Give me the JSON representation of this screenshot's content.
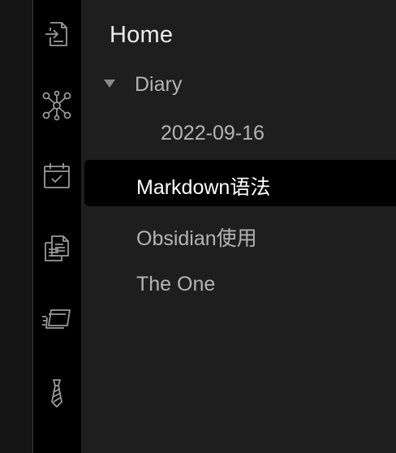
{
  "ribbon": {
    "icons": [
      {
        "name": "open-file-icon"
      },
      {
        "name": "graph-view-icon"
      },
      {
        "name": "daily-note-icon"
      },
      {
        "name": "copy-note-icon"
      },
      {
        "name": "slides-icon"
      },
      {
        "name": "plugin-icon"
      }
    ]
  },
  "sidebar": {
    "title": "Home",
    "folder": {
      "label": "Diary",
      "expanded": true
    },
    "folder_items": [
      "2022-09-16"
    ],
    "items": [
      {
        "label": "Markdown语法",
        "active": true
      },
      {
        "label": "Obsidian使用",
        "active": false
      },
      {
        "label": "The One",
        "active": false
      }
    ]
  },
  "colors": {
    "background": "#1e1e1e",
    "ribbon": "#000000",
    "active_row": "#000000",
    "text": "#b4b4b4",
    "active_text": "#ffffff",
    "icon": "#9a9a9a"
  }
}
